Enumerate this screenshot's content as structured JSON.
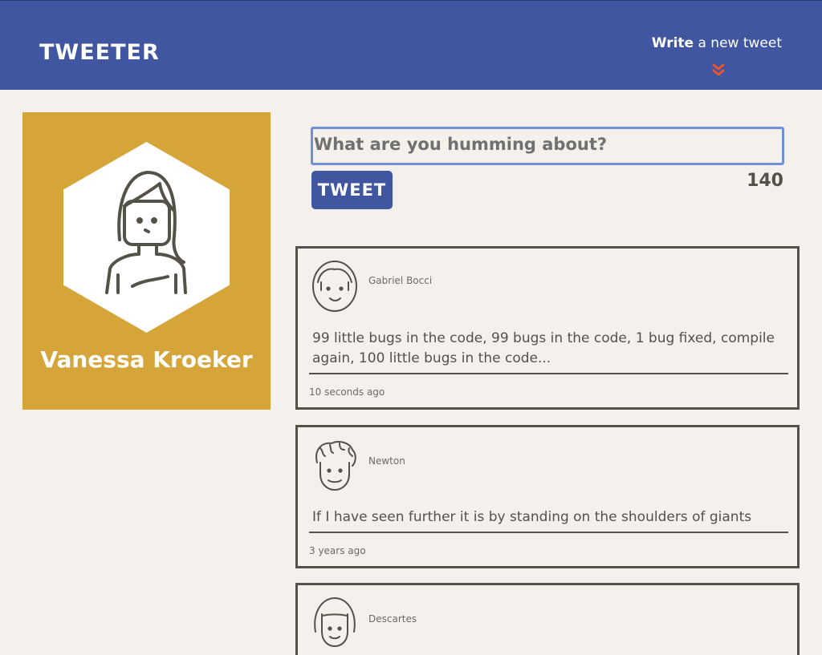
{
  "nav": {
    "brand": "TWEETER",
    "compose_bold": "Write",
    "compose_rest": " a new tweet",
    "chevron_icon": "double-chevron-down-icon",
    "chevron_color": "#e8552f"
  },
  "profile": {
    "name": "Vanessa Kroeker",
    "background_color": "#d6a53a"
  },
  "composer": {
    "placeholder": "What are you humming about?",
    "button_label": "TWEET",
    "counter": "140"
  },
  "tweets": [
    {
      "author": "Gabriel Bocci",
      "text": "99 little bugs in the code, 99 bugs in the code, 1 bug fixed, compile again, 100 little bugs in the code...",
      "time": "10 seconds ago"
    },
    {
      "author": "Newton",
      "text": "If I have seen further it is by standing on the shoulders of giants",
      "time": "3 years ago"
    },
    {
      "author": "Descartes",
      "text": "",
      "time": ""
    }
  ],
  "colors": {
    "nav": "#4056a1",
    "page_background": "#f4f1ec",
    "text": "#545149",
    "input_focus": "#6f8fd6"
  }
}
